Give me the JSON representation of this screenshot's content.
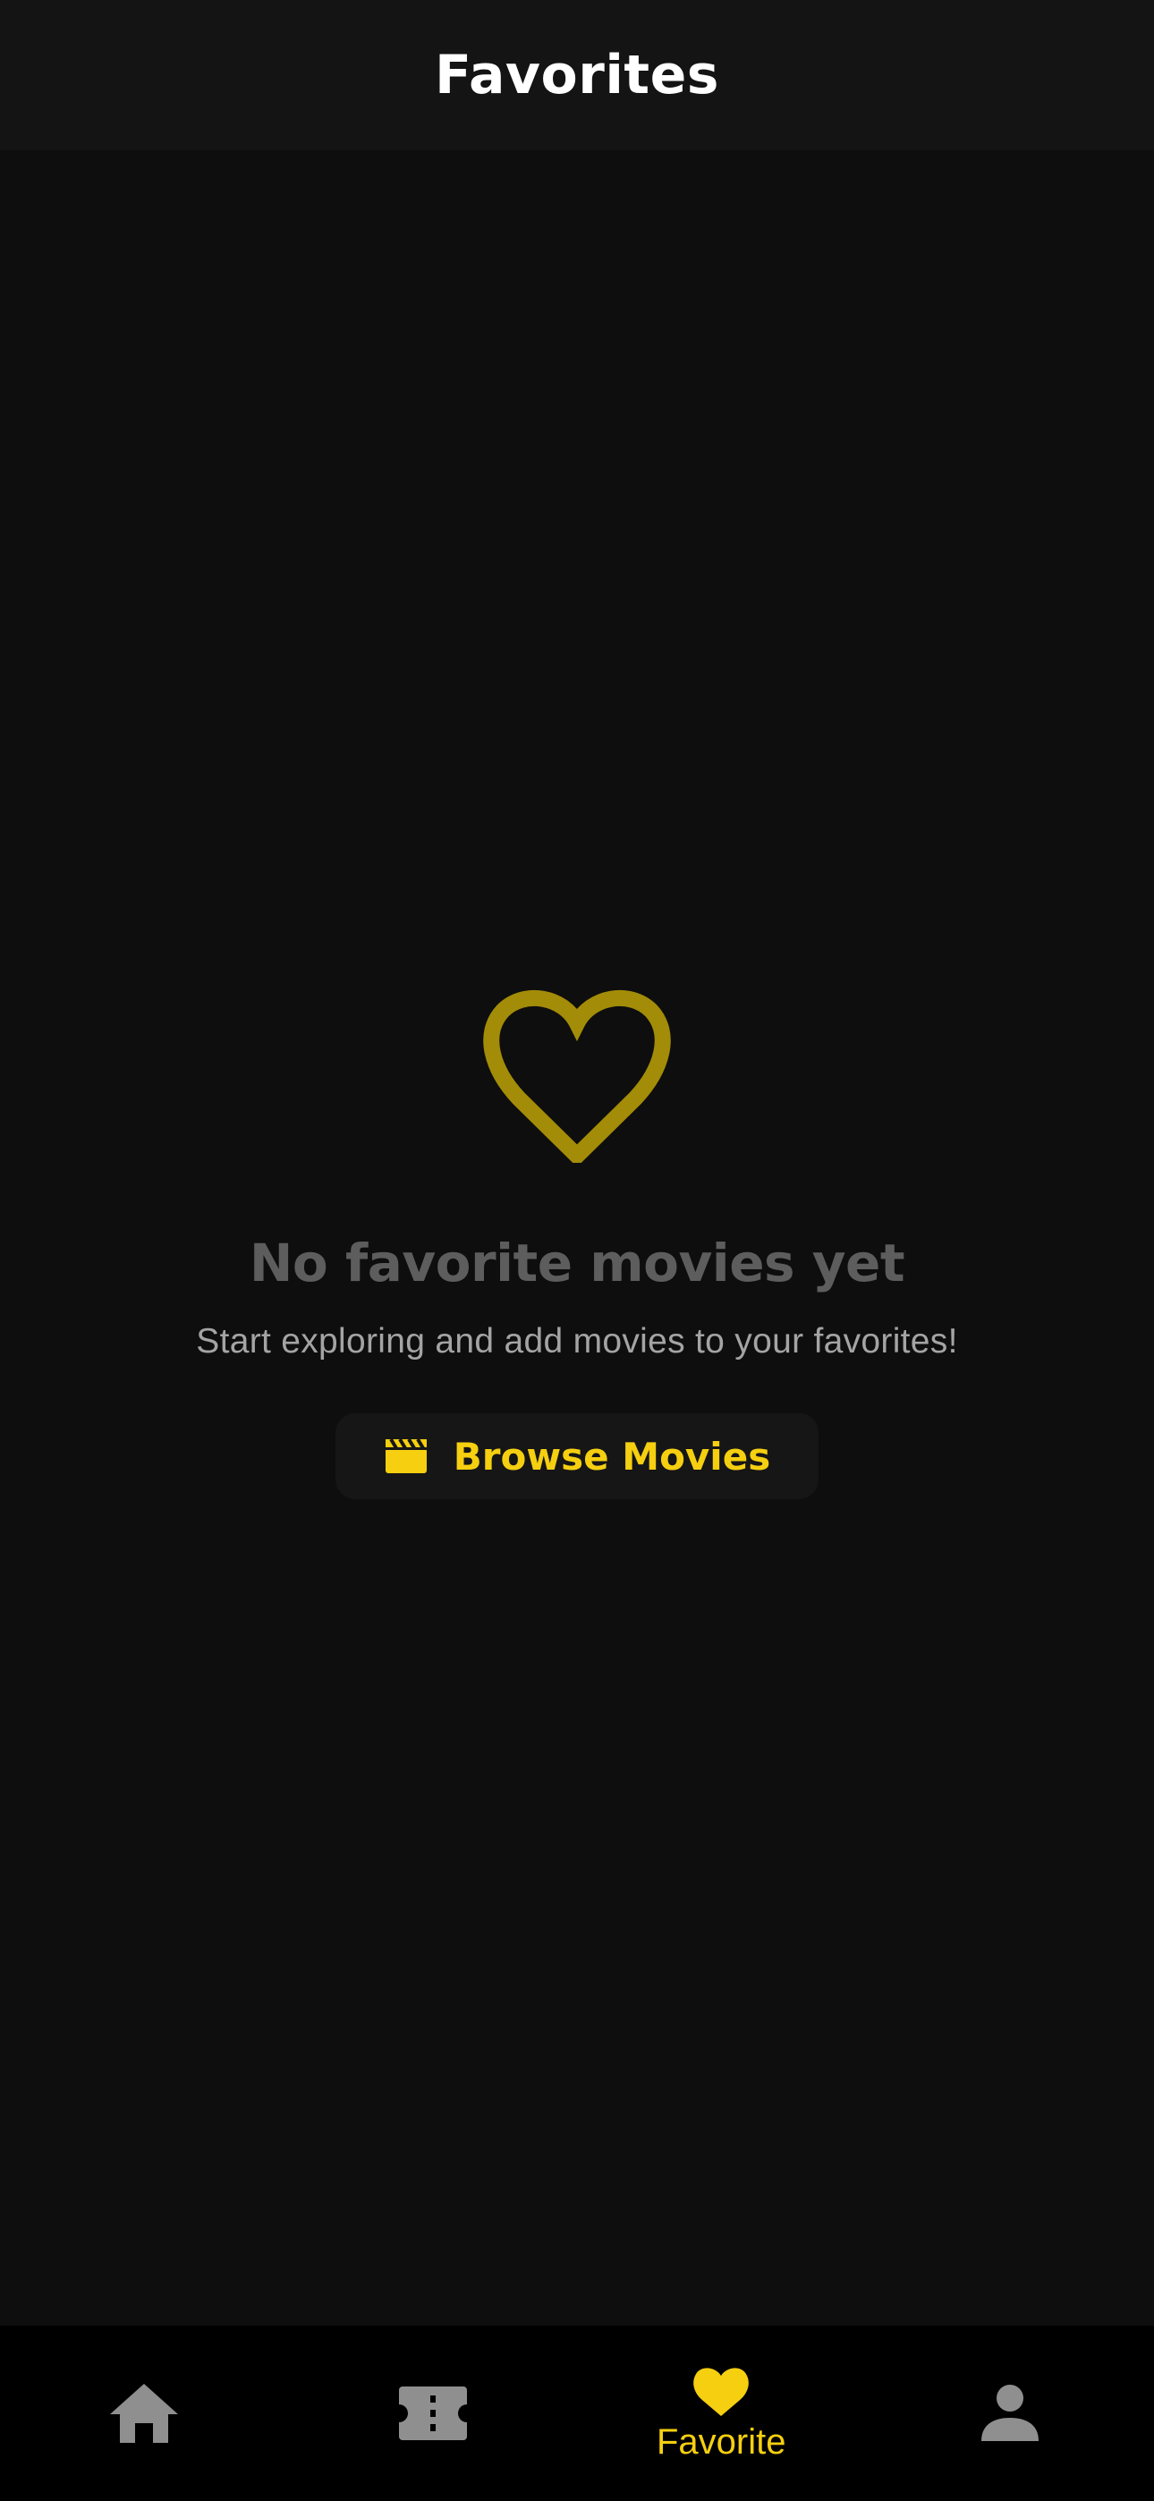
{
  "header": {
    "title": "Favorites"
  },
  "empty_state": {
    "icon": "heart-outline-icon",
    "title": "No favorite movies yet",
    "subtitle": "Start exploring and add movies to your favorites!",
    "button": {
      "icon": "clapperboard-icon",
      "label": "Browse Movies"
    }
  },
  "bottom_nav": {
    "items": [
      {
        "icon": "home-icon",
        "label": "",
        "active": false
      },
      {
        "icon": "ticket-icon",
        "label": "",
        "active": false
      },
      {
        "icon": "heart-icon",
        "label": "Favorite",
        "active": true
      },
      {
        "icon": "person-icon",
        "label": "",
        "active": false
      }
    ]
  },
  "colors": {
    "accent": "#f5cf10",
    "heart_outline": "#a38c08",
    "background": "#0e0e0e",
    "header_bg": "#141414",
    "nav_bg": "#000000",
    "inactive_icon": "#8f8f8f"
  }
}
